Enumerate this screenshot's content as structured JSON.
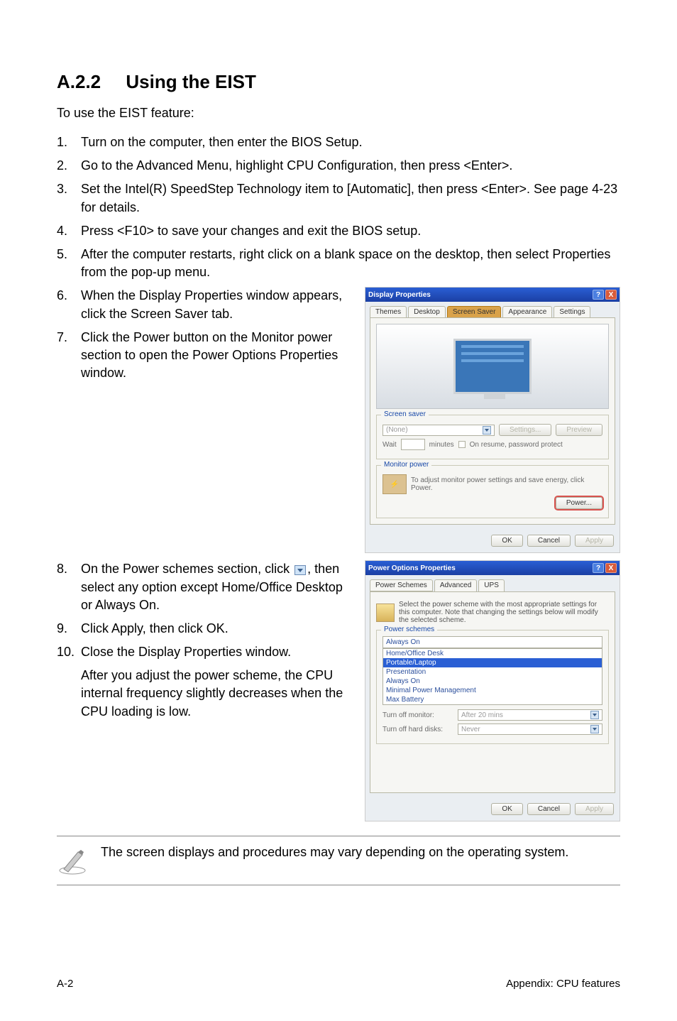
{
  "section": {
    "number": "A.2.2",
    "title": "Using the EIST"
  },
  "intro": "To use the EIST feature:",
  "steps": {
    "s1": "Turn on the computer, then enter the BIOS Setup.",
    "s2": "Go to the Advanced Menu, highlight CPU Configuration, then press <Enter>.",
    "s3": "Set the Intel(R) SpeedStep Technology item to [Automatic], then press <Enter>. See page 4-23 for details.",
    "s4": "Press <F10> to save your changes and exit the BIOS setup.",
    "s5": "After the computer restarts, right click on a blank space on the desktop, then select Properties from the pop-up menu.",
    "s6": "When the Display Properties window appears, click the Screen Saver tab.",
    "s7": "Click the Power button on the Monitor power section to open the Power Options Properties window.",
    "s8a": "On the Power schemes section, click ",
    "s8b": ", then select any option except Home/Office Desktop or Always On.",
    "s9": "Click Apply, then click OK.",
    "s10": "Close the Display Properties window.",
    "afterNote": "After you adjust the power scheme, the CPU internal frequency slightly decreases when the CPU loading is low."
  },
  "note": "The screen displays and procedures may vary depending on the operating system.",
  "displayProps": {
    "title": "Display Properties",
    "tabs": {
      "themes": "Themes",
      "desktop": "Desktop",
      "screensaver": "Screen Saver",
      "appearance": "Appearance",
      "settings": "Settings"
    },
    "group1Title": "Screen saver",
    "saverSelected": "(None)",
    "settingsBtn": "Settings...",
    "previewBtn": "Preview",
    "waitLabel": "Wait",
    "minutesLabel": "minutes",
    "resumeLabel": "On resume, password protect",
    "group2Title": "Monitor power",
    "monitorText": "To adjust monitor power settings and save energy, click Power.",
    "powerBtn": "Power...",
    "ok": "OK",
    "cancel": "Cancel",
    "apply": "Apply"
  },
  "powerOptions": {
    "title": "Power Options Properties",
    "tabs": {
      "schemes": "Power Schemes",
      "advanced": "Advanced",
      "ups": "UPS"
    },
    "infoText": "Select the power scheme with the most appropriate settings for this computer. Note that changing the settings below will modify the selected scheme.",
    "groupTitle": "Power schemes",
    "selected": "Always On",
    "options": {
      "o1": "Home/Office Desk",
      "o2": "Portable/Laptop",
      "o3": "Presentation",
      "o4": "Always On",
      "o5": "Minimal Power Management",
      "o6": "Max Battery"
    },
    "settingsForLabel": "Turn off monitor:",
    "monitorsVal": "After 20 mins",
    "diskLabel": "Turn off hard disks:",
    "diskVal": "Never",
    "ok": "OK",
    "cancel": "Cancel",
    "apply": "Apply"
  },
  "footer": {
    "left": "A-2",
    "right": "Appendix: CPU features"
  }
}
